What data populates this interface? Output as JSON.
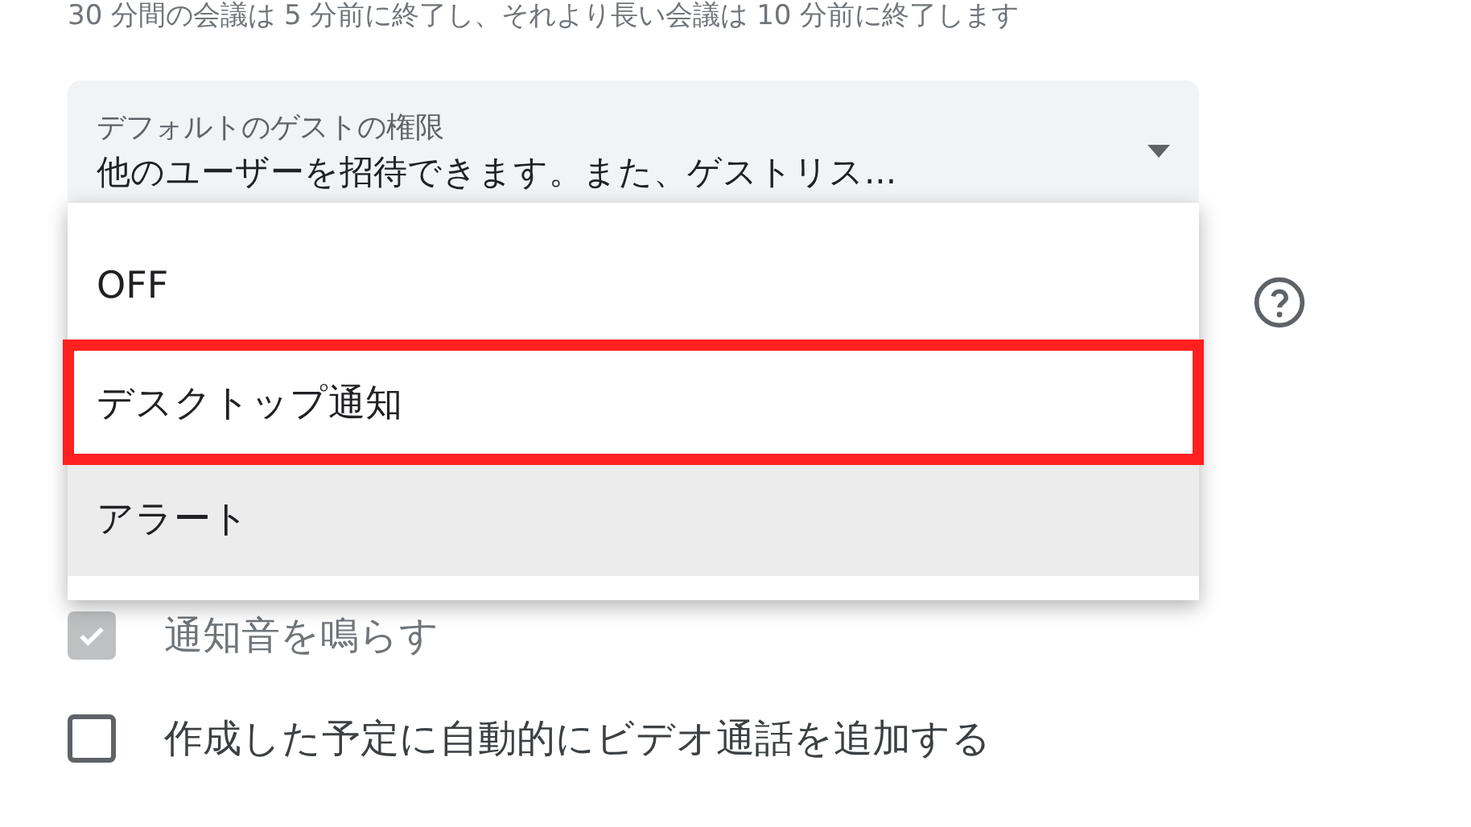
{
  "note": "30 分間の会議は 5 分前に終了し、それより長い会議は 10 分前に終了します",
  "guest_permissions": {
    "label": "デフォルトのゲストの権限",
    "value": "他のユーザーを招待できます。また、ゲストリス..."
  },
  "notification_menu": {
    "options": [
      {
        "label": "OFF",
        "highlighted": false,
        "hovered": false
      },
      {
        "label": "デスクトップ通知",
        "highlighted": true,
        "hovered": false
      },
      {
        "label": "アラート",
        "highlighted": false,
        "hovered": true
      }
    ]
  },
  "checkboxes": [
    {
      "label": "通知音を鳴らす",
      "checked": true,
      "disabled": true
    },
    {
      "label": "作成した予定に自動的にビデオ通話を追加する",
      "checked": false,
      "disabled": false
    }
  ]
}
